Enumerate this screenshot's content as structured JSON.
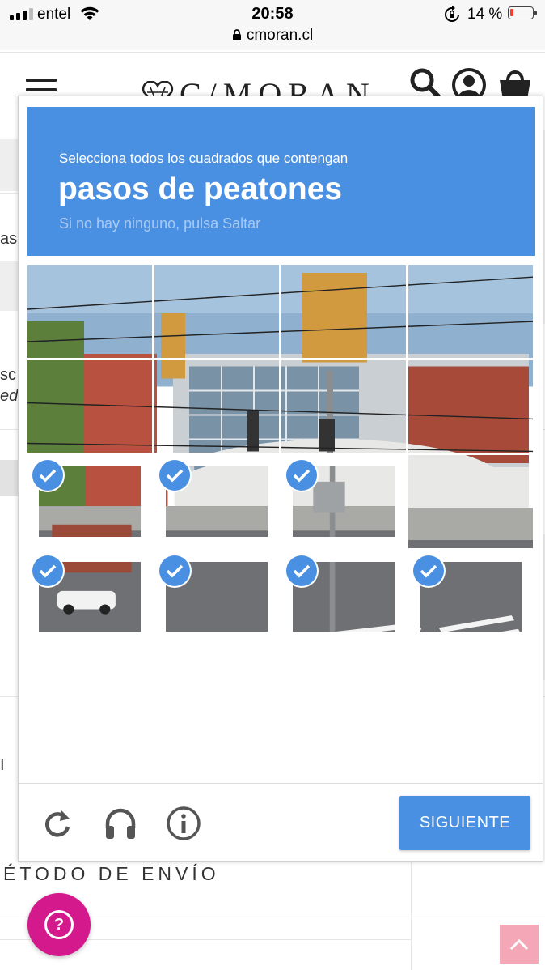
{
  "status_bar": {
    "carrier": "entel",
    "time": "20:58",
    "url": "cmoran.cl",
    "battery": "14 %"
  },
  "site": {
    "logo": "C/MORAN",
    "fragments": [
      "as",
      "sc",
      "ed",
      "I F"
    ],
    "section_title": "ÉTODO DE ENVÍO"
  },
  "captcha": {
    "instruction": "Selecciona todos los cuadrados que contengan",
    "target": "pasos de peatones",
    "skip_hint": "Si no hay ninguno, pulsa Saltar",
    "next_label": "SIGUIENTE",
    "tools": [
      "reload-icon",
      "headphones-icon",
      "info-icon"
    ],
    "grid": {
      "rows": 4,
      "cols": 4,
      "selected": [
        [
          false,
          false,
          false,
          false
        ],
        [
          false,
          false,
          false,
          false
        ],
        [
          true,
          true,
          true,
          false
        ],
        [
          true,
          true,
          true,
          true
        ]
      ]
    }
  },
  "colors": {
    "accent": "#4a90e2",
    "help_button": "#d3198b",
    "scroll_top": "#f4a7b6"
  }
}
